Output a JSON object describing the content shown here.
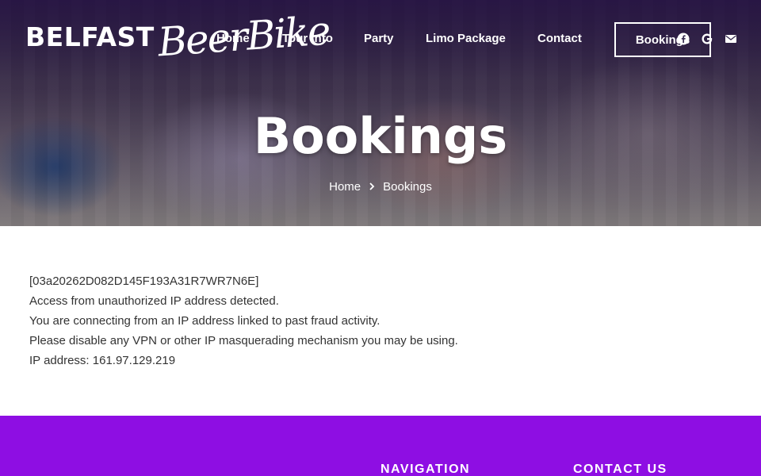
{
  "brand": {
    "word": "BELFAST",
    "script": "BeerBike"
  },
  "nav": {
    "items": [
      "Home",
      "Tour Info",
      "Party",
      "Limo Package",
      "Contact"
    ],
    "cta": "Bookings"
  },
  "social": [
    "facebook-icon",
    "google-icon",
    "envelope-icon"
  ],
  "hero": {
    "title": "Bookings",
    "breadcrumb": {
      "home": "Home",
      "current": "Bookings"
    }
  },
  "message": {
    "lines": [
      "[03a20262D082D145F193A31R7WR7N6E]",
      "Access from unauthorized IP address detected.",
      "You are connecting from an IP address linked to past fraud activity.",
      "Please disable any VPN or other IP masquerading mechanism you may be using.",
      "IP address: 161.97.129.219"
    ]
  },
  "footer": {
    "navigation_heading": "NAVIGATION",
    "contact_heading": "CONTACT US"
  },
  "colors": {
    "footer_bg": "#8e0ee3",
    "hero_overlay": "#281446",
    "text": "#333333"
  }
}
